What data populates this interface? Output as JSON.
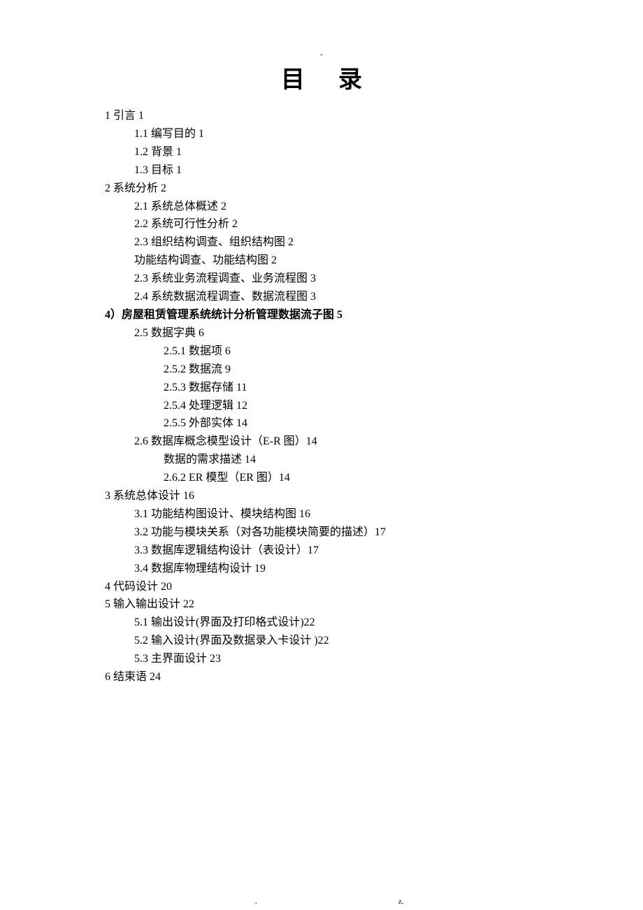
{
  "header_mark": "-",
  "title": "目录",
  "toc": [
    {
      "level": 0,
      "bold": false,
      "text": "1 引言 1"
    },
    {
      "level": 1,
      "bold": false,
      "text": "1.1 编写目的 1"
    },
    {
      "level": 1,
      "bold": false,
      "text": "1.2 背景 1"
    },
    {
      "level": 1,
      "bold": false,
      "text": "1.3 目标 1"
    },
    {
      "level": 0,
      "bold": false,
      "text": "2 系统分析 2"
    },
    {
      "level": 1,
      "bold": false,
      "text": "2.1 系统总体概述 2"
    },
    {
      "level": 1,
      "bold": false,
      "text": "2.2 系统可行性分析 2"
    },
    {
      "level": 1,
      "bold": false,
      "text": "2.3 组织结构调查、组织结构图 2"
    },
    {
      "level": 1,
      "bold": false,
      "text": "功能结构调查、功能结构图 2"
    },
    {
      "level": 1,
      "bold": false,
      "text": "2.3 系统业务流程调查、业务流程图 3"
    },
    {
      "level": 1,
      "bold": false,
      "text": "2.4 系统数据流程调查、数据流程图 3"
    },
    {
      "level": 0,
      "bold": true,
      "text": "4）房屋租赁管理系统统计分析管理数据流子图 5"
    },
    {
      "level": 1,
      "bold": false,
      "text": "2.5 数据字典 6"
    },
    {
      "level": 2,
      "bold": false,
      "text": "2.5.1 数据项 6"
    },
    {
      "level": 2,
      "bold": false,
      "text": "2.5.2 数据流 9"
    },
    {
      "level": 2,
      "bold": false,
      "text": "2.5.3 数据存储 11"
    },
    {
      "level": 2,
      "bold": false,
      "text": "2.5.4 处理逻辑 12"
    },
    {
      "level": 2,
      "bold": false,
      "text": "2.5.5 外部实体 14"
    },
    {
      "level": 1,
      "bold": false,
      "text": "2.6 数据库概念模型设计（E-R 图）14"
    },
    {
      "level": 2,
      "bold": false,
      "text": "数据的需求描述 14"
    },
    {
      "level": 2,
      "bold": false,
      "text": "2.6.2 ER 模型（ER 图）14"
    },
    {
      "level": 0,
      "bold": false,
      "text": "3 系统总体设计 16"
    },
    {
      "level": 1,
      "bold": false,
      "text": "3.1 功能结构图设计、模块结构图 16"
    },
    {
      "level": 1,
      "bold": false,
      "text": "3.2 功能与模块关系（对各功能模块简要的描述）17"
    },
    {
      "level": 1,
      "bold": false,
      "text": "3.3 数据库逻辑结构设计（表设计）17"
    },
    {
      "level": 1,
      "bold": false,
      "text": "3.4 数据库物理结构设计 19"
    },
    {
      "level": 0,
      "bold": false,
      "text": "4 代码设计 20"
    },
    {
      "level": 0,
      "bold": false,
      "text": "5 输入输出设计 22"
    },
    {
      "level": 1,
      "bold": false,
      "text": "5.1 输出设计(界面及打印格式设计)22"
    },
    {
      "level": 1,
      "bold": false,
      "text": "5.2 输入设计(界面及数据录入卡设计 )22"
    },
    {
      "level": 1,
      "bold": false,
      "text": "5.3 主界面设计 23"
    },
    {
      "level": 0,
      "bold": false,
      "text": "6 结束语 24"
    }
  ],
  "footer": {
    "dot": ".",
    "z": "z."
  }
}
